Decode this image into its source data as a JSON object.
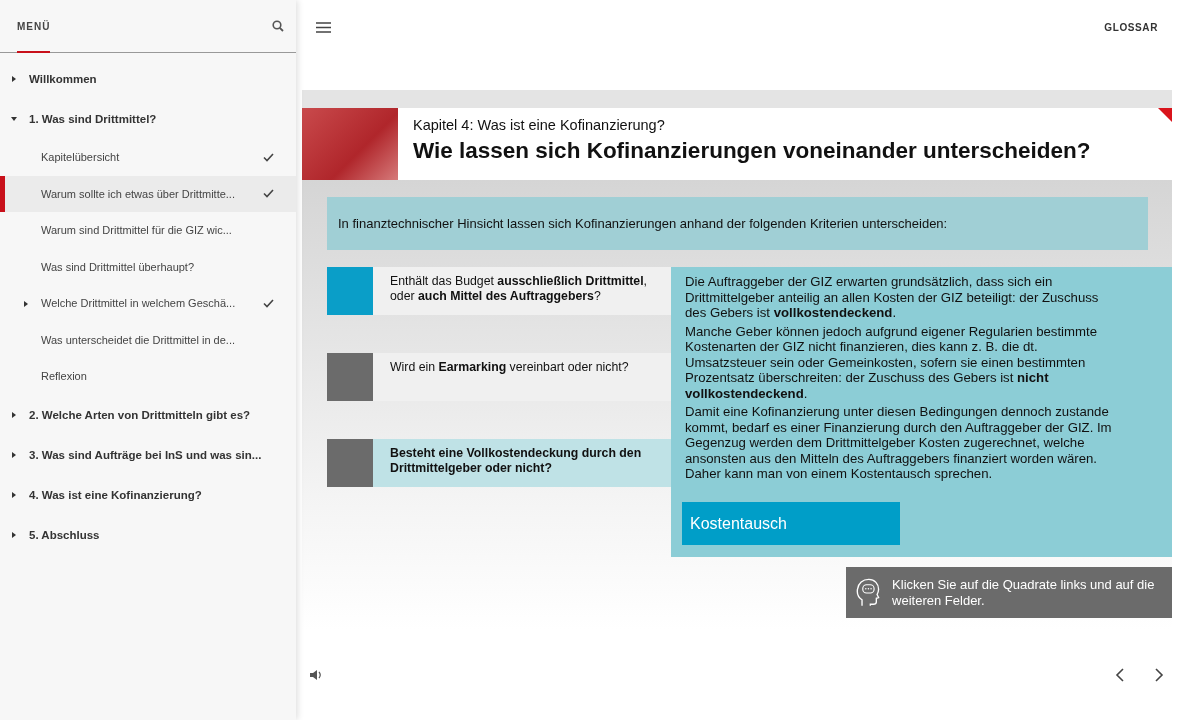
{
  "sidebar": {
    "title": "MENÜ",
    "items": [
      {
        "label": "Willkommen",
        "expanded": false,
        "selected": false
      },
      {
        "label": "1. Was sind Drittmittel?",
        "expanded": true,
        "selected": false,
        "children": [
          {
            "label": "Kapitelübersicht",
            "completed": true,
            "selected": false
          },
          {
            "label": "Warum sollte ich etwas über Drittmitte...",
            "completed": true,
            "selected": true
          },
          {
            "label": "Warum sind Drittmittel für die GIZ wic...",
            "completed": false,
            "selected": false
          },
          {
            "label": "Was sind Drittmittel überhaupt?",
            "completed": false,
            "selected": false
          },
          {
            "label": "Welche Drittmittel in welchem Geschä...",
            "completed": true,
            "selected": false,
            "expanded": false
          },
          {
            "label": "Was unterscheidet die Drittmittel in de...",
            "completed": false,
            "selected": false
          },
          {
            "label": "Reflexion",
            "completed": false,
            "selected": false
          }
        ]
      },
      {
        "label": "2. Welche Arten von Drittmitteln gibt es?",
        "expanded": false,
        "selected": false
      },
      {
        "label": "3. Was sind Aufträge bei InS und was sin...",
        "expanded": false,
        "selected": false
      },
      {
        "label": "4. Was ist eine Kofinanzierung?",
        "expanded": false,
        "selected": false
      },
      {
        "label": "5. Abschluss",
        "expanded": false,
        "selected": false
      }
    ]
  },
  "topbar": {
    "glossary": "GLOSSAR"
  },
  "slide": {
    "chapter": "Kapitel 4: Was ist eine Kofinanzierung?",
    "title": "Wie lassen sich Kofinanzierungen voneinander unterscheiden?",
    "intro": "In finanztechnischer Hinsicht lassen sich Kofinanzierungen anhand der folgenden Kriterien unterscheiden:",
    "criteria": [
      {
        "text": "Enthält das Budget **ausschließlich Drittmittel**, oder **auch Mittel des Auftraggebers**?",
        "selected": true,
        "highlighted": false
      },
      {
        "text": "Wird ein **Earmarking** vereinbart oder nicht?",
        "selected": false,
        "highlighted": false
      },
      {
        "text": "Besteht eine Vollkostendeckung durch den Drittmittelgeber oder nicht?",
        "selected": false,
        "highlighted": true
      }
    ],
    "detail_paragraphs": [
      "Die Auftraggeber der GIZ erwarten grundsätzlich, dass sich ein Drittmittelgeber anteilig an allen Kosten der GIZ beteiligt: der Zuschuss des Gebers ist **vollkostendeckend**.",
      "Manche Geber können jedoch aufgrund eigener Regularien bestimmte Kostenarten der GIZ nicht finanzieren, dies kann z. B. die dt. Umsatzsteuer sein oder Gemeinkosten, sofern sie einen bestimmten Prozentsatz überschreiten: der Zuschuss des Gebers ist **nicht vollkostendeckend**.",
      "Damit eine Kofinanzierung unter diesen Bedingungen dennoch zustande kommt, bedarf es einer Finanzierung durch den Auftraggeber der GIZ. Im Gegenzug werden dem Drittmittelgeber Kosten zugerechnet, welche ansonsten aus den Mitteln des Auftraggebers finanziert worden wären. Daher kann man von einem Kostentausch sprechen."
    ],
    "detail_button": "Kostentausch",
    "hint": "Klicken Sie auf die Quadrate links und auf die weiteren Felder."
  }
}
